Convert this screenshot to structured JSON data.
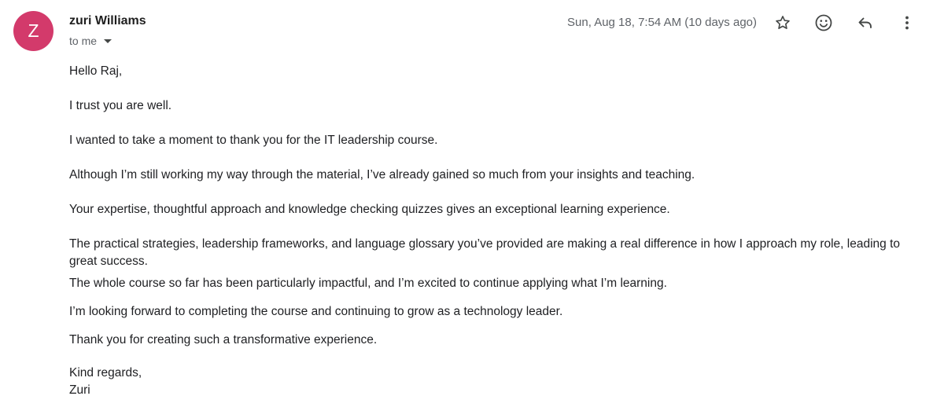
{
  "sender": {
    "avatar_letter": "Z",
    "avatar_color": "#d33a6b",
    "name": "zuri Williams",
    "recipient": "to me"
  },
  "header": {
    "timestamp": "Sun, Aug 18, 7:54 AM (10 days ago)",
    "actions": [
      "star-icon",
      "emoji-icon",
      "reply-icon",
      "more-vert-icon"
    ]
  },
  "email": {
    "greeting": "Hello Raj,",
    "paragraphs": [
      "I trust you are well.",
      "I wanted to take a moment to thank you for the IT leadership course.",
      "Although I’m still working my way through the material, I’ve already gained so much from your insights and teaching.",
      "Your expertise, thoughtful approach and knowledge checking quizzes gives an exceptional learning experience.",
      "The practical strategies, leadership frameworks, and language glossary you’ve provided are making a real difference in how I approach my role, leading to great success.",
      "The whole course so far has been particularly impactful, and I’m excited to continue applying what I’m learning.",
      "I’m looking forward to completing the course and continuing to grow as a technology leader.",
      "Thank you for creating such a transformative experience."
    ],
    "sign_off": "Kind regards,",
    "signature": "Zuri"
  }
}
